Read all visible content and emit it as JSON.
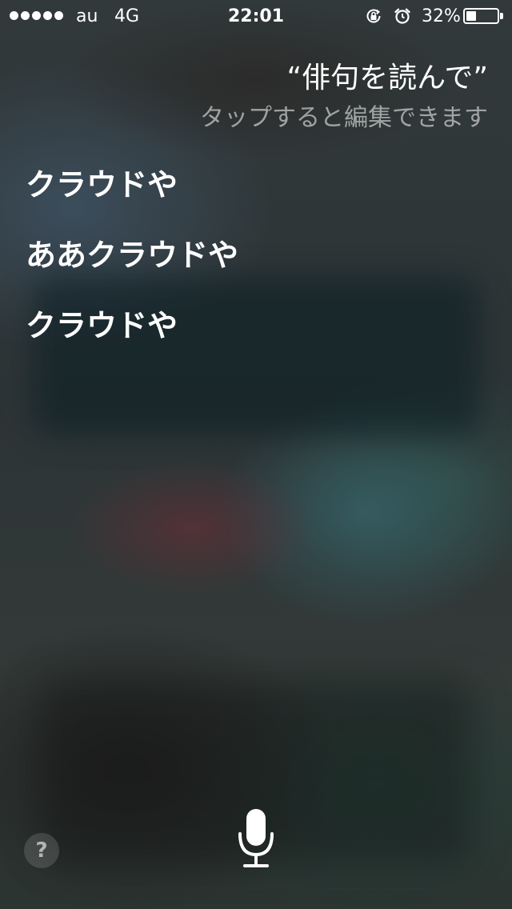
{
  "status_bar": {
    "carrier": "au",
    "network": "4G",
    "time": "22:01",
    "battery_percent": "32%",
    "battery_level": 0.32,
    "icons": [
      "signal-dots",
      "rotation-lock-icon",
      "alarm-icon",
      "battery-icon"
    ]
  },
  "siri": {
    "query": "“俳句を読んで”",
    "edit_hint": "タップすると編集できます",
    "response_lines": [
      "クラウドや",
      "ああクラウドや",
      "クラウドや"
    ]
  },
  "controls": {
    "help_label": "?",
    "mic_icon": "microphone-icon"
  },
  "colors": {
    "text": "#ffffff",
    "hint_text": "#a9acac"
  }
}
